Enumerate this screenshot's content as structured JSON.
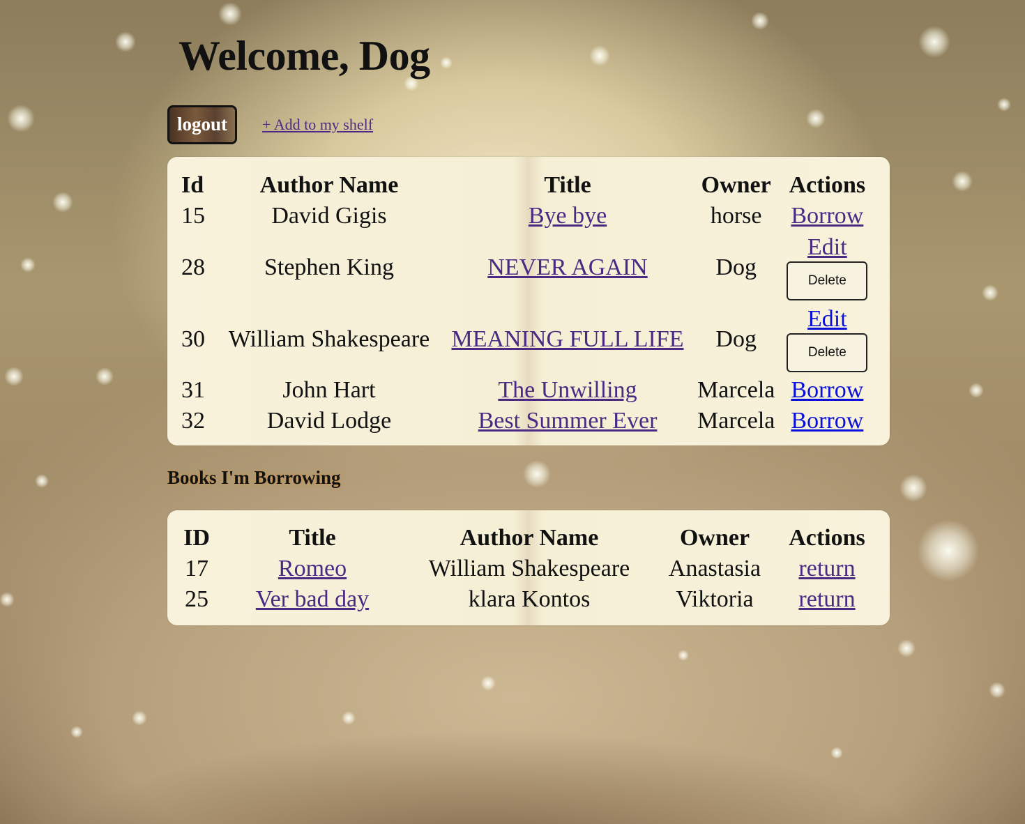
{
  "header": {
    "title": "Welcome, Dog",
    "logout_label": "logout",
    "add_link_label": "+ Add to my shelf"
  },
  "shelf": {
    "columns": [
      "Id",
      "Author Name",
      "Title",
      "Owner",
      "Actions"
    ],
    "rows": [
      {
        "id": "15",
        "author": "David Gigis",
        "title": "Bye bye",
        "owner": "horse",
        "action": "Borrow"
      },
      {
        "id": "28",
        "author": "Stephen King",
        "title": "NEVER AGAIN",
        "owner": "Dog",
        "edit": "Edit",
        "delete": "Delete"
      },
      {
        "id": "30",
        "author": "William Shakespeare",
        "title": "MEANING FULL LIFE",
        "owner": "Dog",
        "edit": "Edit",
        "delete": "Delete"
      },
      {
        "id": "31",
        "author": "John Hart",
        "title": "The Unwilling",
        "owner": "Marcela",
        "action": "Borrow"
      },
      {
        "id": "32",
        "author": "David Lodge",
        "title": "Best Summer Ever",
        "owner": "Marcela",
        "action": "Borrow"
      }
    ]
  },
  "borrowing": {
    "heading": "Books I'm Borrowing",
    "columns": [
      "ID",
      "Title",
      "Author Name",
      "Owner",
      "Actions"
    ],
    "rows": [
      {
        "id": "17",
        "title": "Romeo",
        "author": "William Shakespeare",
        "owner": "Anastasia",
        "action": "return"
      },
      {
        "id": "25",
        "title": "Ver bad day",
        "author": "klara Kontos",
        "owner": "Viktoria",
        "action": "return"
      }
    ]
  },
  "colors": {
    "visited_link": "#4b2a84",
    "link": "#0b10d8",
    "panel_bg": "#f8f2dc"
  }
}
